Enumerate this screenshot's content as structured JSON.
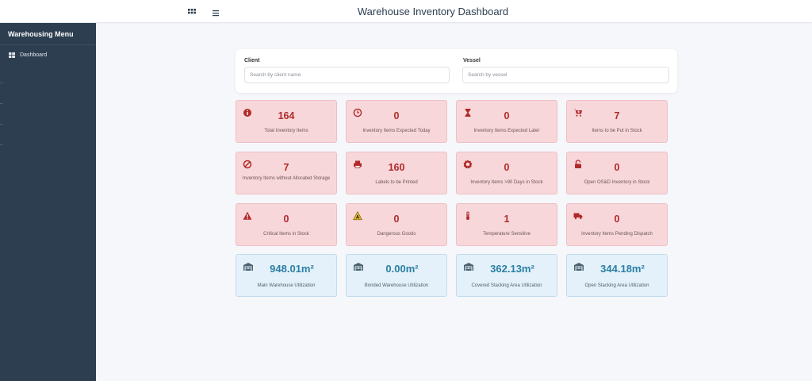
{
  "header": {
    "title": "Warehouse Inventory Dashboard"
  },
  "sidebar": {
    "heading": "Warehousing Menu",
    "items": [
      {
        "label": "Dashboard",
        "icon": "table-icon"
      }
    ]
  },
  "filters": {
    "client": {
      "label": "Client",
      "placeholder": "Search by client name",
      "value": ""
    },
    "vessel": {
      "label": "Vessel",
      "placeholder": "Search by vessel",
      "value": ""
    }
  },
  "colors": {
    "sidebar": "#2c3e50",
    "alert_card_bg": "#f8d7da",
    "alert_value": "#b02a2a",
    "info_card_bg": "#e4f1fa",
    "info_value": "#2b7fa3"
  },
  "cards": [
    {
      "value": "164",
      "label": "Total Inventory Items",
      "icon": "info-icon"
    },
    {
      "value": "0",
      "label": "Inventory Items Expected Today",
      "icon": "clock-icon"
    },
    {
      "value": "0",
      "label": "Inventory Items Expected Later",
      "icon": "hourglass-icon"
    },
    {
      "value": "7",
      "label": "Items to be Put in Stock",
      "icon": "cart-plus-icon"
    },
    {
      "value": "7",
      "label": "Inventory Items without Allocated Storage",
      "icon": "ban-icon"
    },
    {
      "value": "160",
      "label": "Labels to be Printed",
      "icon": "printer-icon"
    },
    {
      "value": "0",
      "label": "Inventory Items >90 Days in Stock",
      "icon": "badge-alert-icon"
    },
    {
      "value": "0",
      "label": "Open OS&D Inventory in Stock",
      "icon": "unlock-icon"
    },
    {
      "value": "0",
      "label": "Critical Items in Stock",
      "icon": "warning-icon"
    },
    {
      "value": "0",
      "label": "Dangerous Goods",
      "icon": "biohazard-icon"
    },
    {
      "value": "1",
      "label": "Temperature Sensitive",
      "icon": "thermometer-icon"
    },
    {
      "value": "0",
      "label": "Inventory Items Pending Dispatch",
      "icon": "truck-icon"
    },
    {
      "value": "948.01m²",
      "label": "Main Warehouse Utilization",
      "icon": "warehouse-icon"
    },
    {
      "value": "0.00m²",
      "label": "Bonded Warehouse Utilization",
      "icon": "warehouse-icon"
    },
    {
      "value": "362.13m²",
      "label": "Covered Stacking Area Utilization",
      "icon": "warehouse-icon"
    },
    {
      "value": "344.18m²",
      "label": "Open Stacking Area Utilization",
      "icon": "warehouse-icon"
    }
  ]
}
